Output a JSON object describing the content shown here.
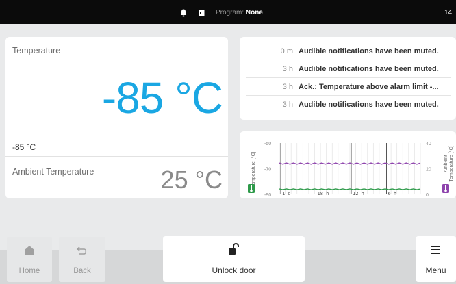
{
  "status_bar": {
    "icons": [
      "bell-icon",
      "door-status-icon"
    ],
    "program_label": "Program:",
    "program_value": "None",
    "clock_partial": "14:"
  },
  "temperature_panel": {
    "label": "Temperature",
    "value": "-85 °C",
    "setpoint": "-85 °C",
    "ambient_label": "Ambient Temperature",
    "ambient_value": "25 °C",
    "accent_color": "#1aa7e3"
  },
  "events": [
    {
      "time": "0 m",
      "message": "Audible notifications have been muted."
    },
    {
      "time": "3 h",
      "message": "Audible notifications have been muted."
    },
    {
      "time": "3 h",
      "message": "Ack.: Temperature above alarm limit -..."
    },
    {
      "time": "3 h",
      "message": "Audible notifications have been muted."
    }
  ],
  "chart_data": {
    "type": "line",
    "ylabel_left": "Temperature [°C]",
    "ylabel_right": "Ambient Temperature [°C]",
    "yticks_left": [
      "-50",
      "-70",
      "-90"
    ],
    "yticks_right": [
      "40",
      "20",
      "0"
    ],
    "ylim_left": [
      -90,
      -50
    ],
    "ylim_right": [
      0,
      40
    ],
    "xticks": [
      "1 d",
      "18 h",
      "12 h",
      "6 h"
    ],
    "grid": true,
    "series": [
      {
        "axis": "left",
        "color": "#2e9a4a",
        "approx_value": -86
      },
      {
        "axis": "right",
        "color": "#8e44ad",
        "approx_value": 24
      }
    ],
    "left_icon_color": "#2e9a4a",
    "right_icon_color": "#8e44ad"
  },
  "nav": {
    "home_label": "Home",
    "back_label": "Back",
    "unlock_label": "Unlock door",
    "menu_label": "Menu"
  }
}
